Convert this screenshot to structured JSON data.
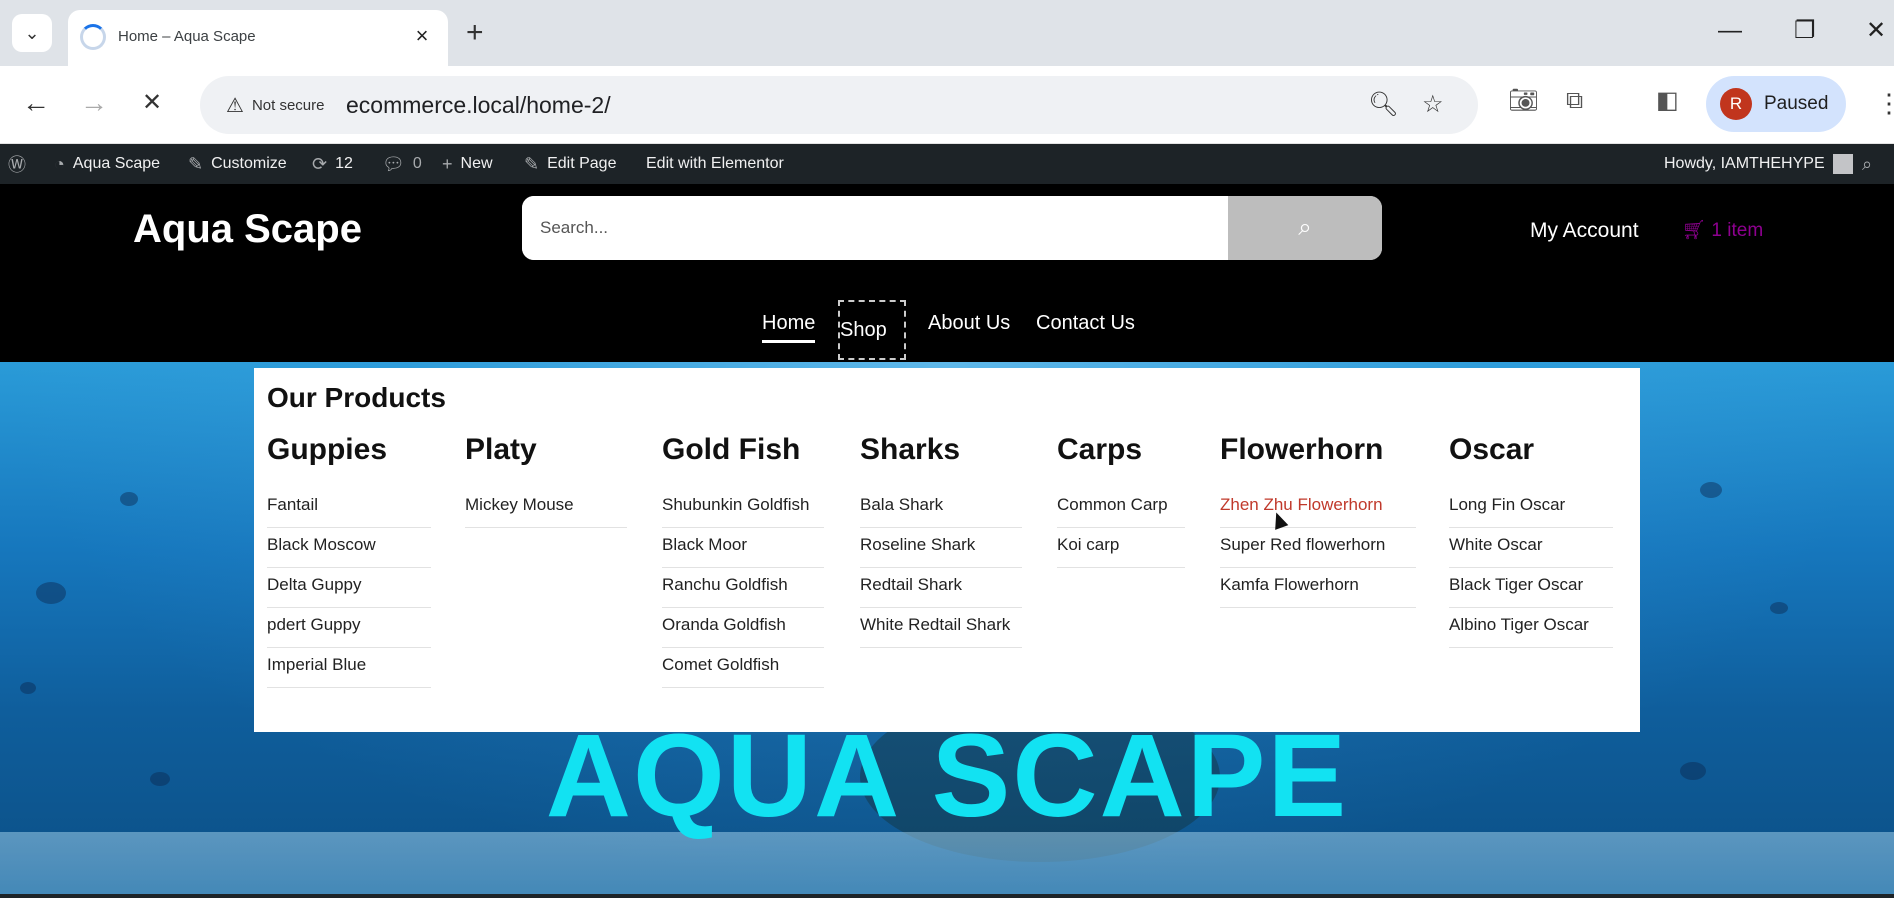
{
  "browser": {
    "tab": {
      "title": "Home – Aqua Scape"
    },
    "new_tab": "+",
    "window": {
      "minimize": "—",
      "restore": "❐",
      "close": "✕"
    },
    "toolbar": {
      "back": "←",
      "forward": "→",
      "stop": "✕",
      "security": "Not secure",
      "url": "ecommerce.local/home-2/",
      "profile_initial": "R",
      "profile_status": "Paused"
    }
  },
  "admin_bar": {
    "site": "Aqua Scape",
    "customize": "Customize",
    "updates": "12",
    "comments": "0",
    "new": "New",
    "edit_page": "Edit Page",
    "elementor": "Edit with Elementor",
    "howdy": "Howdy, IAMTHEHYPE"
  },
  "header": {
    "logo": "Aqua Scape",
    "search_placeholder": "Search...",
    "my_account": "My Account",
    "cart": "1 item",
    "nav": {
      "home": "Home",
      "shop": "Shop",
      "about": "About Us",
      "contact": "Contact Us"
    }
  },
  "mega_menu": {
    "title": "Our Products",
    "columns": [
      {
        "heading": "Guppies",
        "items": [
          "Fantail",
          "Black Moscow",
          "Delta Guppy",
          "pdert Guppy",
          "Imperial Blue"
        ]
      },
      {
        "heading": "Platy",
        "items": [
          "Mickey Mouse"
        ]
      },
      {
        "heading": "Gold Fish",
        "items": [
          "Shubunkin Goldfish",
          "Black Moor",
          "Ranchu Goldfish",
          "Oranda Goldfish",
          "Comet Goldfish"
        ]
      },
      {
        "heading": "Sharks",
        "items": [
          "Bala Shark",
          "Roseline Shark",
          "Redtail Shark",
          "White Redtail Shark"
        ]
      },
      {
        "heading": "Carps",
        "items": [
          "Common Carp",
          "Koi carp"
        ]
      },
      {
        "heading": "Flowerhorn",
        "items": [
          "Zhen Zhu Flowerhorn",
          "Super Red flowerhorn",
          "Kamfa Flowerhorn"
        ]
      },
      {
        "heading": "Oscar",
        "items": [
          "Long Fin Oscar",
          "White Oscar",
          "Black Tiger Oscar",
          "Albino Tiger Oscar"
        ]
      }
    ]
  },
  "hero": {
    "title": "AQUA SCAPE"
  },
  "colors": {
    "accent": "#12e2f2",
    "cart": "#8e0090",
    "active_link": "#c0392b",
    "admin_bar": "#1d2327"
  }
}
